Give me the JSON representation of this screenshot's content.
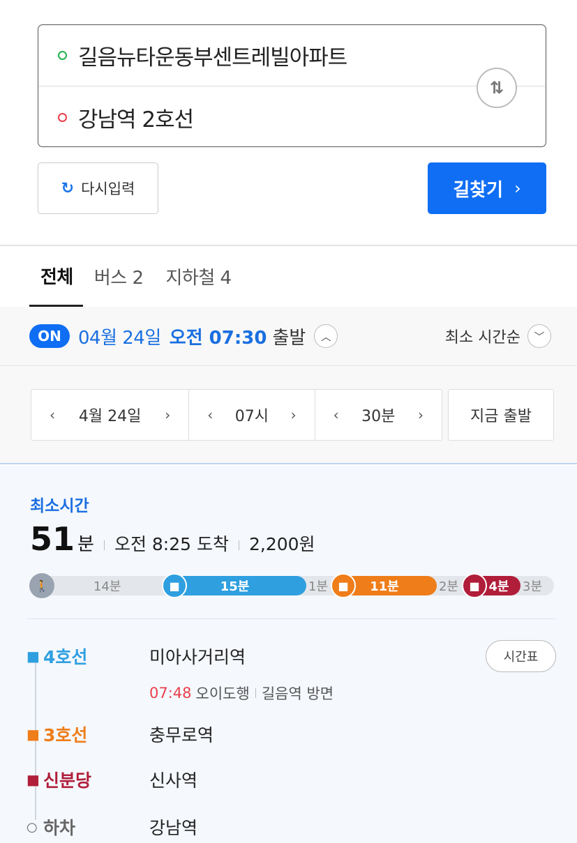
{
  "search": {
    "origin": "길음뉴타운동부센트레빌아파트",
    "destination": "강남역 2호선",
    "swap_icon": "⇅"
  },
  "actions": {
    "reset_label": "다시입력",
    "find_label": "길찾기"
  },
  "tabs": [
    {
      "label": "전체"
    },
    {
      "label": "버스 2"
    },
    {
      "label": "지하철 4"
    }
  ],
  "time_option": {
    "badge": "ON",
    "date": "04월 24일",
    "time": "오전 07:30",
    "departure": "출발",
    "sort": "최소 시간순"
  },
  "picker": {
    "date": "4월 24일",
    "hour": "07시",
    "minute": "30분",
    "now": "지금 출발"
  },
  "result": {
    "tag": "최소시간",
    "duration_num": "51",
    "duration_unit": "분",
    "arrival": "오전 8:25 도착",
    "fare": "2,200원",
    "segments": {
      "walk": "14분",
      "line4": "15분",
      "transfer1": "1분",
      "line3": "11분",
      "transfer2": "2분",
      "sinbundang": "4분",
      "walk_end": "3분"
    },
    "colors": {
      "line4": "#2f9fe0",
      "line3": "#ee7d1a",
      "sinbundang": "#b01e3a",
      "walk": "#9aa3b0"
    },
    "steps": [
      {
        "line": "4호선",
        "station": "미아사거리역"
      },
      {
        "line": "3호선",
        "station": "충무로역"
      },
      {
        "line": "신분당",
        "station": "신사역"
      },
      {
        "line": "하차",
        "station": "강남역"
      }
    ],
    "timetable_label": "시간표",
    "dep_time": "07:48",
    "dep_dir": "오이도행",
    "dep_platform": "길음역 방면"
  }
}
